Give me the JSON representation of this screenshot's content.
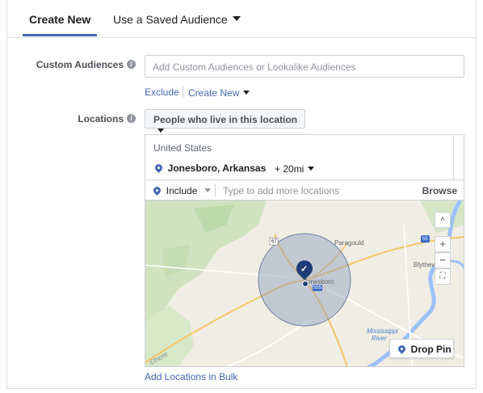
{
  "tabs": {
    "create_new": "Create New",
    "saved_audience": "Use a Saved Audience"
  },
  "custom_audiences": {
    "label": "Custom Audiences",
    "placeholder": "Add Custom Audiences or Lookalike Audiences",
    "exclude": "Exclude",
    "create_new": "Create New"
  },
  "locations": {
    "label": "Locations",
    "selector": "People who live in this location",
    "country": "United States",
    "city": "Jonesboro, Arkansas",
    "radius": "+ 20mi",
    "include": "Include",
    "type_placeholder": "Type to add more locations",
    "browse": "Browse",
    "add_bulk": "Add Locations in Bulk"
  },
  "map": {
    "labels": {
      "paragould": "Paragould",
      "blytheville": "Blytheville",
      "jonesboro": "Jonesboro",
      "mississippi": "Mississippi",
      "river": "River",
      "route67": "67",
      "route55": "55",
      "route555": "555",
      "watermark": "©here"
    },
    "zoom_in": "+",
    "zoom_out": "−",
    "drop_pin": "Drop Pin"
  },
  "colors": {
    "accent": "#4267b2",
    "water": "#9cc0f9",
    "radius_fill": "#8c9ebb"
  }
}
